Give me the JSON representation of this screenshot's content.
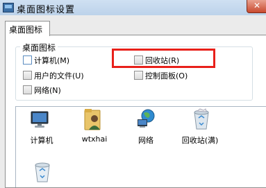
{
  "window": {
    "title": "桌面图标设置",
    "close_glyph": "✕"
  },
  "tabs": [
    {
      "label": "桌面图标"
    }
  ],
  "group": {
    "label": "桌面图标"
  },
  "checkboxes": [
    {
      "label": "计算机(M)",
      "checked": false
    },
    {
      "label": "回收站(R)",
      "checked": false
    },
    {
      "label": "用户的文件(U)",
      "checked": false
    },
    {
      "label": "控制面板(O)",
      "checked": false
    },
    {
      "label": "网络(N)",
      "checked": false
    }
  ],
  "icons": [
    {
      "label": "计算机",
      "icon": "computer-icon"
    },
    {
      "label": "wtxhai",
      "icon": "user-folder-icon"
    },
    {
      "label": "网络",
      "icon": "network-icon"
    },
    {
      "label": "回收站(满)",
      "icon": "recycle-bin-full-icon"
    },
    {
      "label": "",
      "icon": "recycle-bin-empty-icon"
    }
  ],
  "colors": {
    "highlight": "#e8201a",
    "accent": "#3a6ea5"
  }
}
